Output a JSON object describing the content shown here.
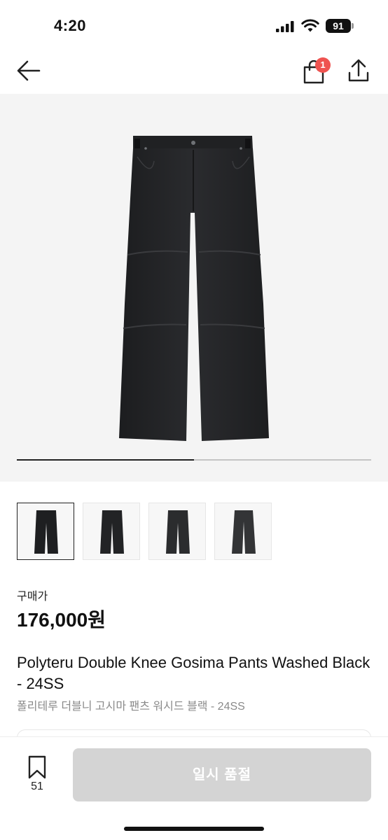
{
  "status_bar": {
    "time": "4:20",
    "battery": "91"
  },
  "nav": {
    "back_icon": "arrow-left-icon",
    "cart_icon": "shopping-bag-icon",
    "cart_badge": "1",
    "share_icon": "share-icon",
    "badge_color": "#ef5350"
  },
  "gallery": {
    "progress_fraction": 0.5,
    "thumbnail_count": 4,
    "selected_index": 0
  },
  "product": {
    "price_label": "구매가",
    "price": "176,000원",
    "title": "Polyteru Double Knee Gosima Pants Washed Black - 24SS",
    "subtitle": "폴리테루 더블니 고시마 팬츠 워시드 블랙 - 24SS"
  },
  "bottom_bar": {
    "wishlist_icon": "bookmark-icon",
    "wishlist_count": "51",
    "cta_label": "일시 품절",
    "cta_color": "#d4d4d4"
  }
}
